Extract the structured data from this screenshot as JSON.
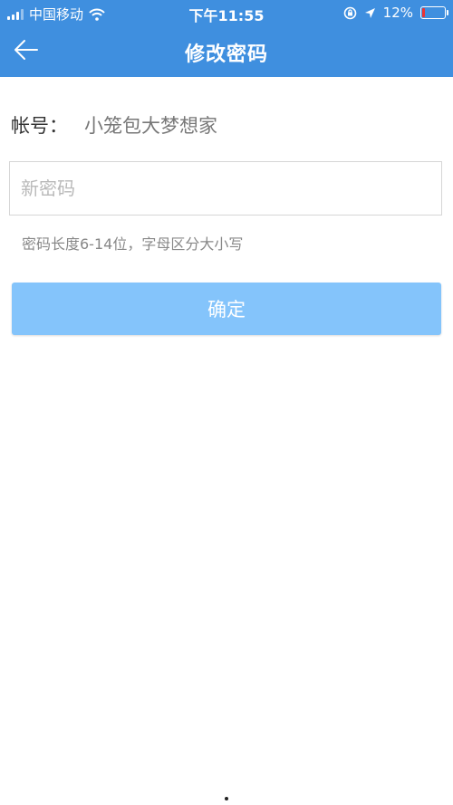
{
  "status_bar": {
    "carrier": "中国移动",
    "time": "下午11:55",
    "battery_percent": "12%",
    "battery_level": 0.12,
    "icons": [
      "signal-icon",
      "wifi-icon",
      "rotation-lock-icon",
      "location-icon",
      "battery-icon"
    ]
  },
  "nav": {
    "title": "修改密码",
    "back_icon": "arrow-left-icon",
    "background_color": "#3f8fdf"
  },
  "account": {
    "label": "帐号：",
    "value": "小笼包大梦想家"
  },
  "password_field": {
    "value": "",
    "placeholder": "新密码"
  },
  "hint": "密码长度6-14位，字母区分大小写",
  "confirm_button": {
    "label": "确定",
    "color": "#84c4fb"
  }
}
